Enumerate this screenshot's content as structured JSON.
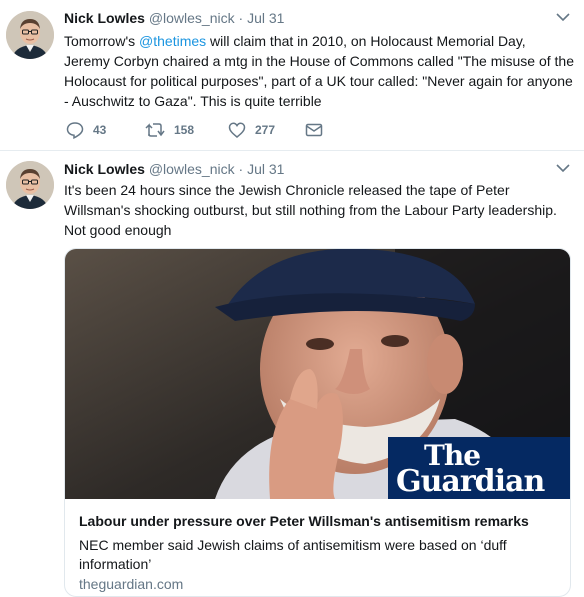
{
  "tweets": [
    {
      "name": "Nick Lowles",
      "handle": "@lowles_nick",
      "separator": "·",
      "date": "Jul 31",
      "text_before": "Tomorrow's ",
      "mention": "@thetimes",
      "text_after": " will claim that in 2010, on Holocaust Memorial Day, Jeremy Corbyn chaired a mtg in the House of Commons called \"The misuse of the Holocaust for political purposes\", part of a UK tour called: \"Never again for anyone - Auschwitz to Gaza\". This is quite terrible",
      "replies": "43",
      "retweets": "158",
      "likes": "277"
    },
    {
      "name": "Nick Lowles",
      "handle": "@lowles_nick",
      "separator": "·",
      "date": "Jul 31",
      "text": "It's been 24 hours since the Jewish Chronicle released the tape of Peter Willsman's shocking outburst, but still nothing from the Labour Party leadership. Not good enough",
      "card": {
        "logo_line1": "The",
        "logo_line2": "Guardian",
        "title": "Labour under pressure over Peter Willsman's antisemitism remarks",
        "description": "NEC member said Jewish claims of antisemitism were based on ‘duff information’",
        "domain": "theguardian.com"
      }
    }
  ],
  "icons": {
    "reply": "reply-icon",
    "retweet": "retweet-icon",
    "like": "heart-icon",
    "dm": "envelope-icon",
    "caret": "chevron-down-icon"
  },
  "colors": {
    "link": "#1b95e0",
    "secondary": "#657786",
    "guardian_blue": "#052962"
  }
}
